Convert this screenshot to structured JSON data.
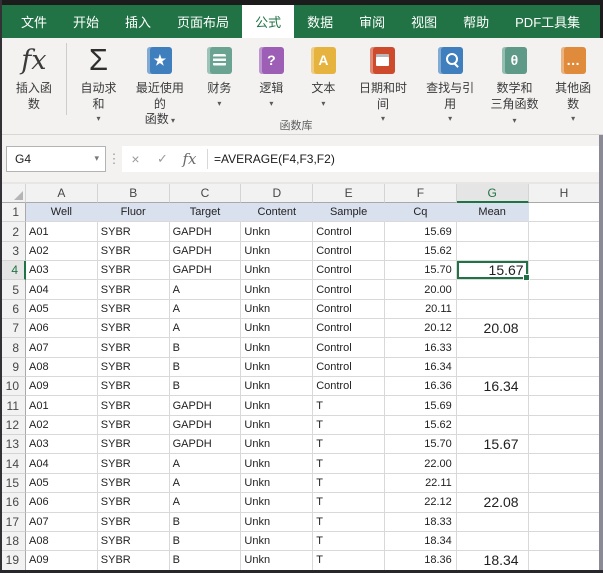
{
  "tabbar": {
    "tabs": [
      {
        "label": "文件",
        "active": false
      },
      {
        "label": "开始",
        "active": false
      },
      {
        "label": "插入",
        "active": false
      },
      {
        "label": "页面布局",
        "active": false
      },
      {
        "label": "公式",
        "active": true
      },
      {
        "label": "数据",
        "active": false
      },
      {
        "label": "审阅",
        "active": false
      },
      {
        "label": "视图",
        "active": false
      },
      {
        "label": "帮助",
        "active": false
      },
      {
        "label": "PDF工具集",
        "active": false
      }
    ]
  },
  "ribbon": {
    "group_label": "函数库",
    "dropdown_caret": "▾",
    "buttons": [
      {
        "id": "insert-function",
        "label": "插入函数",
        "icon": "fx-icon",
        "glyph": "fx",
        "dropdown": false
      },
      {
        "id": "autosum",
        "label": "自动求和",
        "icon": "sigma-icon",
        "glyph": "Σ",
        "dropdown": true
      },
      {
        "id": "recent-functions",
        "label": "最近使用的\n函数",
        "icon": "book-star-icon",
        "glyph": "★",
        "color": "#3F7FBE",
        "dropdown": true
      },
      {
        "id": "financial",
        "label": "财务",
        "icon": "book-coins-icon",
        "color": "#6BA392",
        "dropdown": true
      },
      {
        "id": "logical",
        "label": "逻辑",
        "icon": "book-question-icon",
        "glyph": "?",
        "color": "#9C5FB5",
        "dropdown": true
      },
      {
        "id": "text",
        "label": "文本",
        "icon": "book-a-icon",
        "glyph": "A",
        "color": "#E6B33F",
        "dropdown": true
      },
      {
        "id": "date-time",
        "label": "日期和时间",
        "icon": "book-calendar-icon",
        "color": "#CE4A2C",
        "dropdown": true
      },
      {
        "id": "lookup-reference",
        "label": "查找与引用",
        "icon": "book-search-icon",
        "color": "#3F7FBE",
        "dropdown": true
      },
      {
        "id": "math-trig",
        "label": "数学和\n三角函数",
        "icon": "book-theta-icon",
        "glyph": "θ",
        "color": "#5F9A89",
        "dropdown": true
      },
      {
        "id": "more-functions",
        "label": "其他函数",
        "icon": "book-more-icon",
        "glyph": "…",
        "color": "#E08A3C",
        "dropdown": true
      }
    ]
  },
  "formula_bar": {
    "name_box": "G4",
    "name_box_caret": "▾",
    "handle": "⋮",
    "cancel_icon": "×",
    "enter_icon": "✓",
    "fx_icon": "fx",
    "formula": "=AVERAGE(F4,F3,F2)"
  },
  "sheet": {
    "column_letters": [
      "A",
      "B",
      "C",
      "D",
      "E",
      "F",
      "G",
      "H"
    ],
    "selected": {
      "cell": "G4",
      "column": "G",
      "row": 4
    },
    "rows": [
      {
        "n": 1,
        "header": true,
        "cells": [
          "Well",
          "Fluor",
          "Target",
          "Content",
          "Sample",
          "Cq",
          "Mean"
        ]
      },
      {
        "n": 2,
        "cells": [
          "A01",
          "SYBR",
          "GAPDH",
          "Unkn",
          "Control",
          "15.69",
          ""
        ]
      },
      {
        "n": 3,
        "cells": [
          "A02",
          "SYBR",
          "GAPDH",
          "Unkn",
          "Control",
          "15.62",
          ""
        ]
      },
      {
        "n": 4,
        "cells": [
          "A03",
          "SYBR",
          "GAPDH",
          "Unkn",
          "Control",
          "15.70",
          "15.67"
        ]
      },
      {
        "n": 5,
        "cells": [
          "A04",
          "SYBR",
          "A",
          "Unkn",
          "Control",
          "20.00",
          ""
        ]
      },
      {
        "n": 6,
        "cells": [
          "A05",
          "SYBR",
          "A",
          "Unkn",
          "Control",
          "20.11",
          ""
        ]
      },
      {
        "n": 7,
        "cells": [
          "A06",
          "SYBR",
          "A",
          "Unkn",
          "Control",
          "20.12",
          "20.08"
        ]
      },
      {
        "n": 8,
        "cells": [
          "A07",
          "SYBR",
          "B",
          "Unkn",
          "Control",
          "16.33",
          ""
        ]
      },
      {
        "n": 9,
        "cells": [
          "A08",
          "SYBR",
          "B",
          "Unkn",
          "Control",
          "16.34",
          ""
        ]
      },
      {
        "n": 10,
        "cells": [
          "A09",
          "SYBR",
          "B",
          "Unkn",
          "Control",
          "16.36",
          "16.34"
        ]
      },
      {
        "n": 11,
        "cells": [
          "A01",
          "SYBR",
          "GAPDH",
          "Unkn",
          "T",
          "15.69",
          ""
        ]
      },
      {
        "n": 12,
        "cells": [
          "A02",
          "SYBR",
          "GAPDH",
          "Unkn",
          "T",
          "15.62",
          ""
        ]
      },
      {
        "n": 13,
        "cells": [
          "A03",
          "SYBR",
          "GAPDH",
          "Unkn",
          "T",
          "15.70",
          "15.67"
        ]
      },
      {
        "n": 14,
        "cells": [
          "A04",
          "SYBR",
          "A",
          "Unkn",
          "T",
          "22.00",
          ""
        ]
      },
      {
        "n": 15,
        "cells": [
          "A05",
          "SYBR",
          "A",
          "Unkn",
          "T",
          "22.11",
          ""
        ]
      },
      {
        "n": 16,
        "cells": [
          "A06",
          "SYBR",
          "A",
          "Unkn",
          "T",
          "22.12",
          "22.08"
        ]
      },
      {
        "n": 17,
        "cells": [
          "A07",
          "SYBR",
          "B",
          "Unkn",
          "T",
          "18.33",
          ""
        ]
      },
      {
        "n": 18,
        "cells": [
          "A08",
          "SYBR",
          "B",
          "Unkn",
          "T",
          "18.34",
          ""
        ]
      },
      {
        "n": 19,
        "cells": [
          "A09",
          "SYBR",
          "B",
          "Unkn",
          "T",
          "18.36",
          "18.34"
        ]
      }
    ]
  },
  "colors": {
    "ribbon_green": "#217346",
    "selection_green": "#217346",
    "header_row_fill": "#D9E0EE"
  }
}
